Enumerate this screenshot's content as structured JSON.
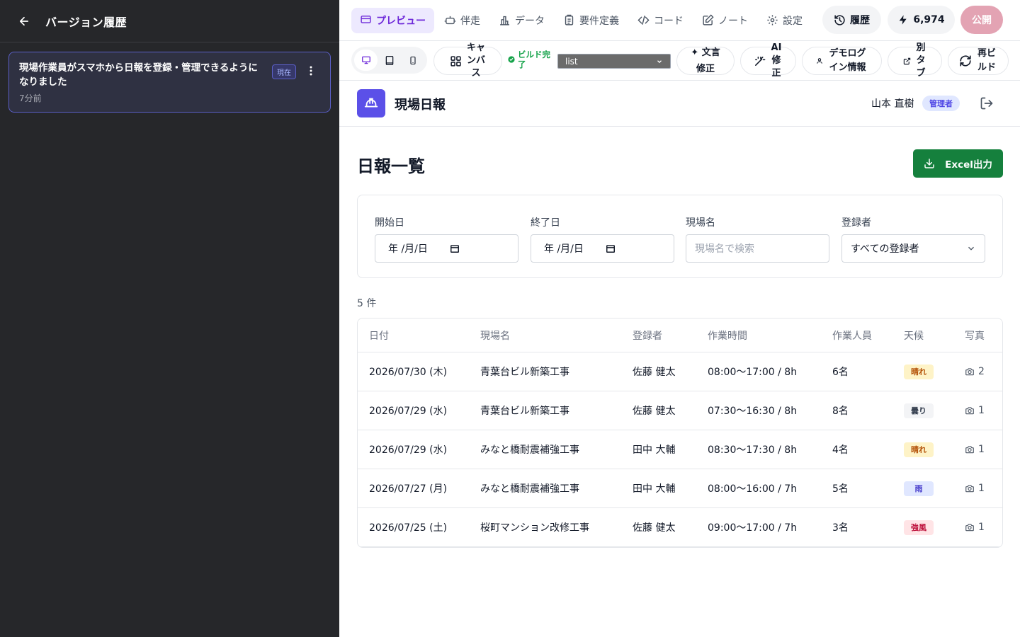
{
  "left": {
    "title": "バージョン履歴",
    "version": {
      "message": "現場作業員がスマホから日報を登録・管理できるようになりました",
      "time": "7分前",
      "badge": "現在"
    }
  },
  "nav": {
    "tabs": [
      {
        "label": "プレビュー",
        "icon": "monitor-icon",
        "active": true
      },
      {
        "label": "伴走",
        "icon": "robot-icon"
      },
      {
        "label": "データ",
        "icon": "chart-icon"
      },
      {
        "label": "要件定義",
        "icon": "clipboard-icon"
      },
      {
        "label": "コード",
        "icon": "code-icon"
      },
      {
        "label": "ノート",
        "icon": "edit-icon"
      },
      {
        "label": "設定",
        "icon": "gear-icon"
      }
    ],
    "history_label": "履歴",
    "credits": "6,974",
    "publish_label": "公開"
  },
  "toolbar": {
    "canvas_label": "キャンバス",
    "build_status": "ビルド完了",
    "page_select": "list",
    "text_fix_label": "✦ 文言修正",
    "ai_fix_label": "AI修正",
    "demo_login_label": "デモログイン情報",
    "new_tab_label": "別タブ",
    "rebuild_label": "再ビルド"
  },
  "app": {
    "name": "現場日報",
    "user_name": "山本 直樹",
    "user_role": "管理者",
    "page_title": "日報一覧",
    "excel_label": "Excel出力",
    "filters": {
      "start_label": "開始日",
      "start_value": "年 /月/日",
      "end_label": "終了日",
      "end_value": "年 /月/日",
      "site_label": "現場名",
      "site_placeholder": "現場名で検索",
      "registrant_label": "登録者",
      "registrant_value": "すべての登録者"
    },
    "count": "5 件",
    "table": {
      "headers": [
        "日付",
        "現場名",
        "登録者",
        "作業時間",
        "作業人員",
        "天候",
        "写真"
      ],
      "rows": [
        {
          "date": "2026/07/30 (木)",
          "site": "青葉台ビル新築工事",
          "registrant": "佐藤 健太",
          "hours": "08:00〜17:00 / 8h",
          "workers": "6名",
          "weather": "晴れ",
          "weather_color": "#b45309",
          "weather_bg": "#fef3c7",
          "photos": "2"
        },
        {
          "date": "2026/07/29 (水)",
          "site": "青葉台ビル新築工事",
          "registrant": "佐藤 健太",
          "hours": "07:30〜16:30 / 8h",
          "workers": "8名",
          "weather": "曇り",
          "weather_color": "#374151",
          "weather_bg": "#f3f4f6",
          "photos": "1"
        },
        {
          "date": "2026/07/29 (水)",
          "site": "みなと橋耐震補強工事",
          "registrant": "田中 大輔",
          "hours": "08:30〜17:30 / 8h",
          "workers": "4名",
          "weather": "晴れ",
          "weather_color": "#b45309",
          "weather_bg": "#fef3c7",
          "photos": "1"
        },
        {
          "date": "2026/07/27 (月)",
          "site": "みなと橋耐震補強工事",
          "registrant": "田中 大輔",
          "hours": "08:00〜16:00 / 7h",
          "workers": "5名",
          "weather": "雨",
          "weather_color": "#4338ca",
          "weather_bg": "#e0e7ff",
          "photos": "1"
        },
        {
          "date": "2026/07/25 (土)",
          "site": "桜町マンション改修工事",
          "registrant": "佐藤 健太",
          "hours": "09:00〜17:00 / 7h",
          "workers": "3名",
          "weather": "強風",
          "weather_color": "#be123c",
          "weather_bg": "#ffe4e6",
          "photos": "1"
        }
      ]
    }
  }
}
